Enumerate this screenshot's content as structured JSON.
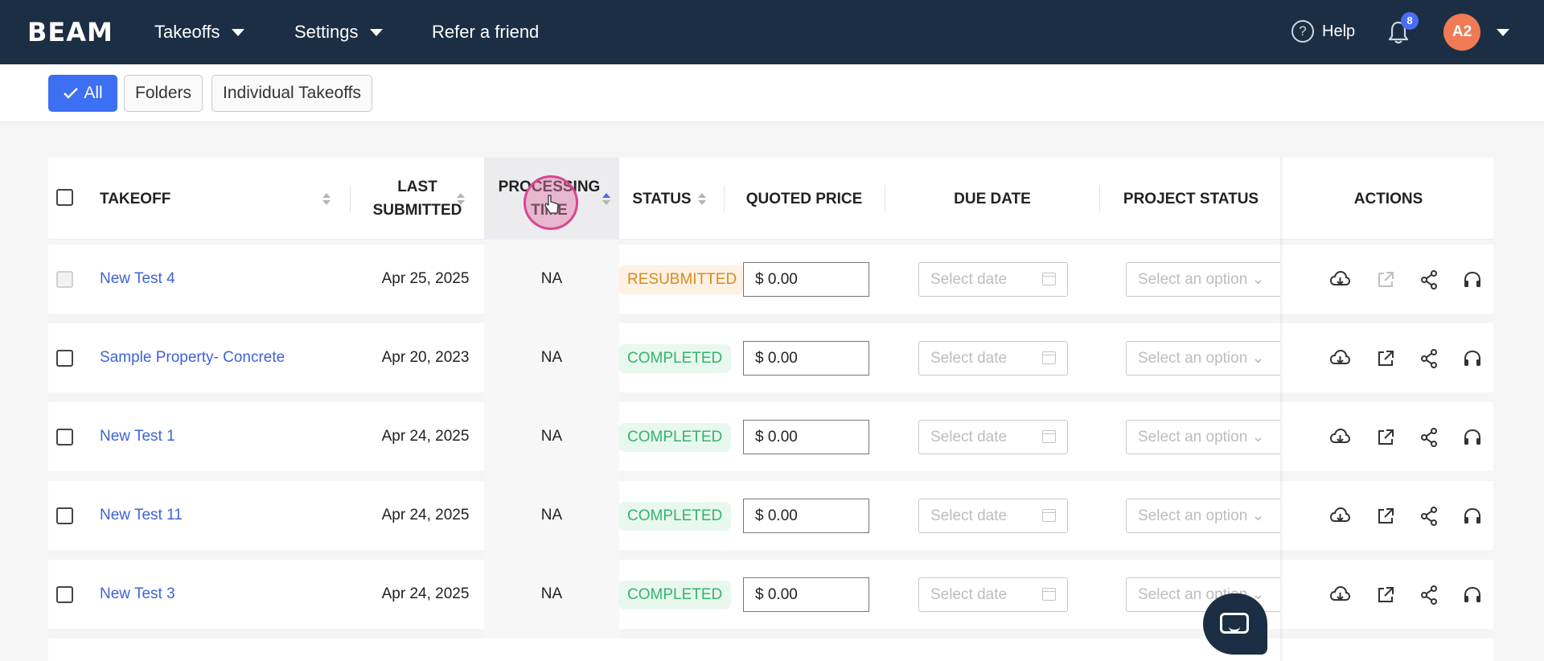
{
  "header": {
    "logo": "BEAM",
    "nav": [
      {
        "label": "Takeoffs",
        "has_dropdown": true
      },
      {
        "label": "Settings",
        "has_dropdown": true
      },
      {
        "label": "Refer a friend",
        "has_dropdown": false
      }
    ],
    "help_label": "Help",
    "notification_count": "8",
    "avatar_initials": "A2",
    "colors": {
      "bar": "#1c2e44",
      "avatar": "#f07a55",
      "badge": "#4a6cf7"
    }
  },
  "filters": {
    "all": "All",
    "folders": "Folders",
    "individual": "Individual Takeoffs",
    "active": "all"
  },
  "table": {
    "columns": {
      "takeoff": "TAKEOFF",
      "last_submitted_1": "LAST",
      "last_submitted_2": "SUBMITTED",
      "processing_1": "PROCESSING",
      "processing_2": "TIME",
      "status": "STATUS",
      "quoted_price": "QUOTED PRICE",
      "due_date": "DUE DATE",
      "project_status": "PROJECT STATUS",
      "actions": "ACTIONS"
    },
    "sorted_column": "processing_time",
    "date_placeholder": "Select date",
    "select_placeholder": "Select an option",
    "rows": [
      {
        "name": "New Test 4",
        "last_submitted": "Apr 25, 2025",
        "processing_time": "NA",
        "status": "RESUBMITTED",
        "price": "$ 0.00",
        "checkbox_disabled": true
      },
      {
        "name": "Sample Property- Concrete",
        "last_submitted": "Apr 20, 2023",
        "processing_time": "NA",
        "status": "COMPLETED",
        "price": "$ 0.00",
        "checkbox_disabled": false
      },
      {
        "name": "New Test 1",
        "last_submitted": "Apr 24, 2025",
        "processing_time": "NA",
        "status": "COMPLETED",
        "price": "$ 0.00",
        "checkbox_disabled": false
      },
      {
        "name": "New Test 11",
        "last_submitted": "Apr 24, 2025",
        "processing_time": "NA",
        "status": "COMPLETED",
        "price": "$ 0.00",
        "checkbox_disabled": false
      },
      {
        "name": "New Test 3",
        "last_submitted": "Apr 24, 2025",
        "processing_time": "NA",
        "status": "COMPLETED",
        "price": "$ 0.00",
        "checkbox_disabled": false
      }
    ],
    "row_actions": [
      "download-icon",
      "open-external-icon",
      "share-icon",
      "support-headset-icon"
    ],
    "status_colors": {
      "COMPLETED": "#35b36b",
      "RESUBMITTED": "#d98a1c"
    }
  },
  "chat_widget_icon": "chat-icon"
}
